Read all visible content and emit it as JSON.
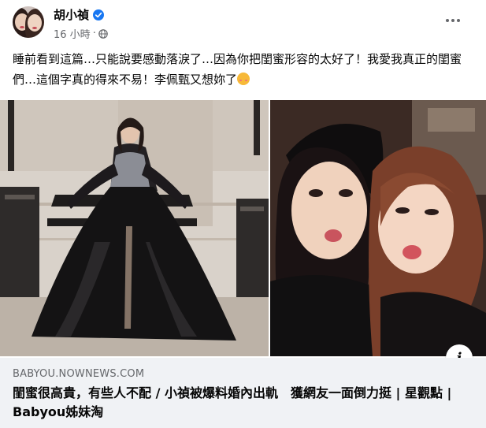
{
  "post": {
    "author": "胡小禎",
    "timestamp": "16 小時",
    "separator": "·",
    "text": "睡前看到這篇…只能說要感動落淚了…因為你把閨蜜形容的太好了！我愛我真正的閨蜜們…這個字真的得來不易！李佩甄又想妳了"
  },
  "icons": {
    "verified": "verified-badge-icon",
    "audience": "globe-icon",
    "menu": "more-options-icon",
    "info": "info-icon",
    "emoji": "smiling-face-with-hearts-emoji"
  },
  "colors": {
    "verified_blue": "#1877f2",
    "secondary_text": "#65676b",
    "link_box_bg": "#f0f2f5"
  },
  "link_preview": {
    "domain": "BABYOU.NOWNEWS.COM",
    "title": "閨蜜很高貴，有些人不配 / 小禎被爆料婚內出軌　獲網友一面倒力挺 | 星觀點 | Babyou姊妹淘",
    "info_button": "i"
  }
}
